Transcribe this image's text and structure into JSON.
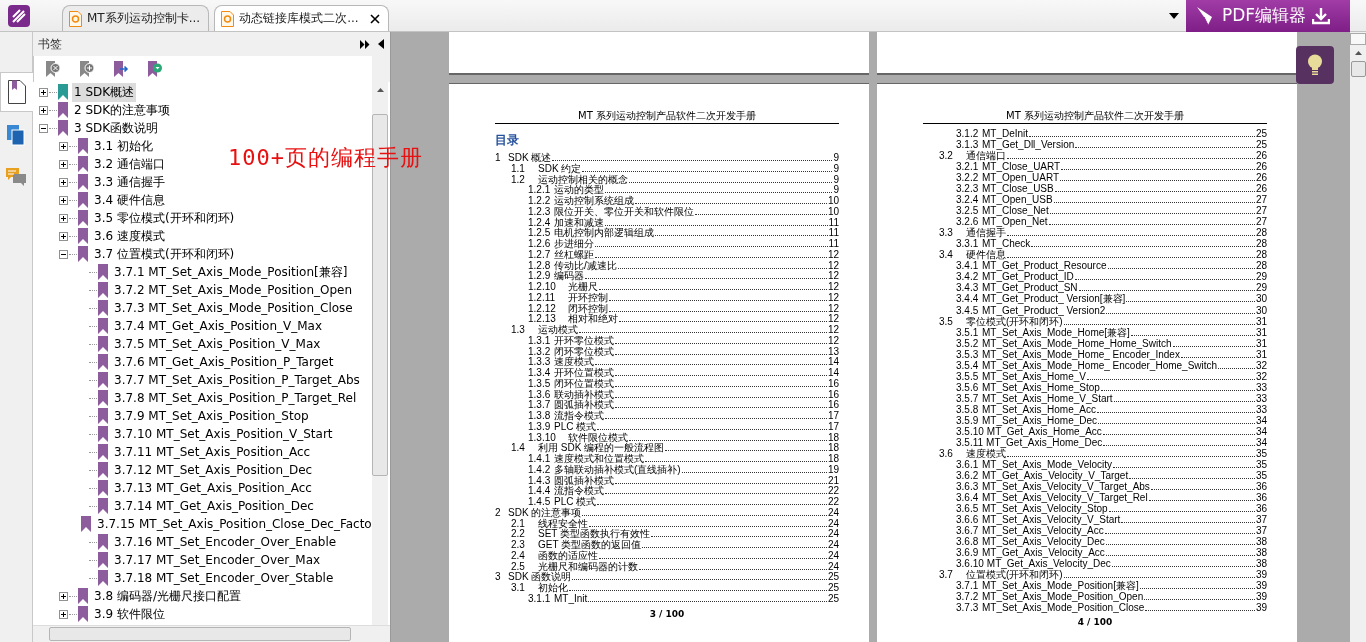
{
  "tabs": [
    {
      "title": "MT系列运动控制卡...",
      "selected": false,
      "closable": false
    },
    {
      "title": "动态链接库模式二次...",
      "selected": true,
      "closable": true
    }
  ],
  "promo_button": {
    "label": "PDF编辑器"
  },
  "side_strip": [
    {
      "kind": "pages",
      "selected": true
    },
    {
      "kind": "layers",
      "selected": false
    },
    {
      "kind": "comments",
      "selected": false
    }
  ],
  "bookmarks": {
    "title": "书签",
    "tree": [
      {
        "label": "1 SDK概述",
        "selected": true,
        "expanded": false
      },
      {
        "label": "2 SDK的注意事项",
        "selected": false,
        "expanded": false
      },
      {
        "label": "3 SDK函数说明",
        "selected": false,
        "expanded": true,
        "children": [
          {
            "label": "3.1 初始化",
            "selected": false,
            "expanded": false
          },
          {
            "label": "3.2 通信端口",
            "selected": false,
            "expanded": false
          },
          {
            "label": "3.3 通信握手",
            "selected": false,
            "expanded": false
          },
          {
            "label": "3.4 硬件信息",
            "selected": false,
            "expanded": false
          },
          {
            "label": "3.5 零位模式(开环和闭环)",
            "selected": false,
            "expanded": false
          },
          {
            "label": "3.6 速度模式",
            "selected": false,
            "expanded": false
          },
          {
            "label": "3.7 位置模式(开环和闭环)",
            "selected": false,
            "expanded": true,
            "children": [
              {
                "label": "3.7.1 MT_Set_Axis_Mode_Position[兼容]",
                "selected": false
              },
              {
                "label": "3.7.2 MT_Set_Axis_Mode_Position_Open",
                "selected": false
              },
              {
                "label": "3.7.3 MT_Set_Axis_Mode_Position_Close",
                "selected": false
              },
              {
                "label": "3.7.4 MT_Get_Axis_Position_V_Max",
                "selected": false
              },
              {
                "label": "3.7.5 MT_Set_Axis_Position_V_Max",
                "selected": false
              },
              {
                "label": "3.7.6 MT_Get_Axis_Position_P_Target",
                "selected": false
              },
              {
                "label": "3.7.7  MT_Set_Axis_Position_P_Target_Abs",
                "selected": false
              },
              {
                "label": "3.7.8 MT_Set_Axis_Position_P_Target_Rel",
                "selected": false
              },
              {
                "label": "3.7.9 MT_Set_Axis_Position_Stop",
                "selected": false
              },
              {
                "label": "3.7.10 MT_Set_Axis_Position_V_Start",
                "selected": false
              },
              {
                "label": "3.7.11 MT_Set_Axis_Position_Acc",
                "selected": false
              },
              {
                "label": "3.7.12 MT_Set_Axis_Position_Dec",
                "selected": false
              },
              {
                "label": "3.7.13 MT_Get_Axis_Position_Acc",
                "selected": false
              },
              {
                "label": "3.7.14 MT_Get_Axis_Position_Dec",
                "selected": false
              },
              {
                "label": "3.7.15 MT_Set_Axis_Position_Close_Dec_Facto",
                "selected": false
              },
              {
                "label": "3.7.16 MT_Set_Encoder_Over_Enable",
                "selected": false
              },
              {
                "label": "3.7.17 MT_Set_Encoder_Over_Max",
                "selected": false
              },
              {
                "label": "3.7.18 MT_Set_Encoder_Over_Stable",
                "selected": false
              }
            ]
          },
          {
            "label": "3.8 编码器/光栅尺接口配置",
            "selected": false,
            "expanded": false
          },
          {
            "label": "3.9 软件限位",
            "selected": false,
            "expanded": false
          }
        ]
      }
    ]
  },
  "annotation": "100+页的编程手册",
  "pages": [
    {
      "header": "MT 系列运动控制产品软件二次开发手册",
      "heading": "目录",
      "footer": "3 / 100",
      "entries": [
        {
          "num": "1",
          "title": "SDK 概述",
          "page": "9",
          "kind": "chapter"
        },
        {
          "num": "1.1",
          "title": "SDK 约定",
          "page": "9",
          "kind": "section"
        },
        {
          "num": "1.2",
          "title": "运动控制相关的概念",
          "page": "9",
          "kind": "section"
        },
        {
          "num": "1.2.1",
          "title": "运动的类型",
          "page": "9",
          "kind": "item"
        },
        {
          "num": "1.2.2",
          "title": "运动控制系统组成",
          "page": "10",
          "kind": "item"
        },
        {
          "num": "1.2.3",
          "title": "限位开关、零位开关和软件限位",
          "page": "10",
          "kind": "item"
        },
        {
          "num": "1.2.4",
          "title": "加速和减速",
          "page": "11",
          "kind": "item"
        },
        {
          "num": "1.2.5",
          "title": "电机控制内部逻辑组成",
          "page": "11",
          "kind": "item"
        },
        {
          "num": "1.2.6",
          "title": "步进细分",
          "page": "11",
          "kind": "item"
        },
        {
          "num": "1.2.7",
          "title": "丝杠螺距",
          "page": "12",
          "kind": "item"
        },
        {
          "num": "1.2.8",
          "title": "传动比/减速比",
          "page": "12",
          "kind": "item"
        },
        {
          "num": "1.2.9",
          "title": "编码器",
          "page": "12",
          "kind": "item"
        },
        {
          "num": "1.2.10",
          "title": "光栅尺",
          "page": "12",
          "kind": "item_wide"
        },
        {
          "num": "1.2.11",
          "title": "开环控制",
          "page": "12",
          "kind": "item_wide"
        },
        {
          "num": "1.2.12",
          "title": "闭环控制",
          "page": "12",
          "kind": "item_wide"
        },
        {
          "num": "1.2.13",
          "title": "相对和绝对",
          "page": "12",
          "kind": "item_wide"
        },
        {
          "num": "1.3",
          "title": "运动模式",
          "page": "12",
          "kind": "section"
        },
        {
          "num": "1.3.1",
          "title": "开环零位模式",
          "page": "12",
          "kind": "item"
        },
        {
          "num": "1.3.2",
          "title": "闭环零位模式",
          "page": "13",
          "kind": "item"
        },
        {
          "num": "1.3.3",
          "title": "速度模式",
          "page": "14",
          "kind": "item"
        },
        {
          "num": "1.3.4",
          "title": "开环位置模式",
          "page": "14",
          "kind": "item"
        },
        {
          "num": "1.3.5",
          "title": "闭环位置模式",
          "page": "16",
          "kind": "item"
        },
        {
          "num": "1.3.6",
          "title": "联动插补模式",
          "page": "16",
          "kind": "item"
        },
        {
          "num": "1.3.7",
          "title": "圆弧插补模式",
          "page": "16",
          "kind": "item"
        },
        {
          "num": "1.3.8",
          "title": "流指令模式",
          "page": "17",
          "kind": "item"
        },
        {
          "num": "1.3.9",
          "title": "PLC 模式",
          "page": "17",
          "kind": "item"
        },
        {
          "num": "1.3.10",
          "title": "软件限位模式",
          "page": "18",
          "kind": "item_wide"
        },
        {
          "num": "1.4",
          "title": "利用 SDK 编程的一般流程图",
          "page": "18",
          "kind": "section"
        },
        {
          "num": "1.4.1",
          "title": "速度模式和位置模式",
          "page": "18",
          "kind": "item"
        },
        {
          "num": "1.4.2",
          "title": "多轴联动插补模式(直线插补)",
          "page": "19",
          "kind": "item"
        },
        {
          "num": "1.4.3",
          "title": "圆弧插补模式",
          "page": "21",
          "kind": "item"
        },
        {
          "num": "1.4.4",
          "title": "流指令模式",
          "page": "22",
          "kind": "item"
        },
        {
          "num": "1.4.5",
          "title": "PLC 模式",
          "page": "22",
          "kind": "item"
        },
        {
          "num": "2",
          "title": "SDK 的注意事项",
          "page": "24",
          "kind": "chapter"
        },
        {
          "num": "2.1",
          "title": "线程安全性",
          "page": "24",
          "kind": "section"
        },
        {
          "num": "2.2",
          "title": "SET 类型函数执行有效性",
          "page": "24",
          "kind": "section"
        },
        {
          "num": "2.3",
          "title": "GET 类型函数的返回值",
          "page": "24",
          "kind": "section"
        },
        {
          "num": "2.4",
          "title": "函数的适应性",
          "page": "24",
          "kind": "section"
        },
        {
          "num": "2.5",
          "title": "光栅尺和编码器的计数",
          "page": "24",
          "kind": "section"
        },
        {
          "num": "3",
          "title": "SDK 函数说明",
          "page": "25",
          "kind": "chapter"
        },
        {
          "num": "3.1",
          "title": "初始化",
          "page": "25",
          "kind": "section"
        },
        {
          "num": "3.1.1",
          "title": "MT_Init",
          "page": "25",
          "kind": "item"
        }
      ]
    },
    {
      "header": "MT 系列运动控制产品软件二次开发手册",
      "footer": "4 / 100",
      "entries": [
        {
          "num": "3.1.2",
          "title": "MT_DeInit",
          "page": "25",
          "kind": "item"
        },
        {
          "num": "3.1.3",
          "title": "MT_Get_Dll_Version",
          "page": "25",
          "kind": "item"
        },
        {
          "num": "3.2",
          "title": "通信端口",
          "page": "26",
          "kind": "section"
        },
        {
          "num": "3.2.1",
          "title": "MT_Close_UART",
          "page": "26",
          "kind": "item"
        },
        {
          "num": "3.2.2",
          "title": "MT_Open_UART",
          "page": "26",
          "kind": "item"
        },
        {
          "num": "3.2.3",
          "title": "MT_Close_USB",
          "page": "26",
          "kind": "item"
        },
        {
          "num": "3.2.4",
          "title": "MT_Open_USB",
          "page": "27",
          "kind": "item"
        },
        {
          "num": "3.2.5",
          "title": "MT_Close_Net",
          "page": "27",
          "kind": "item"
        },
        {
          "num": "3.2.6",
          "title": "MT_Open_Net",
          "page": "27",
          "kind": "item"
        },
        {
          "num": "3.3",
          "title": "通信握手",
          "page": "28",
          "kind": "section"
        },
        {
          "num": "3.3.1",
          "title": "MT_Check",
          "page": "28",
          "kind": "item"
        },
        {
          "num": "3.4",
          "title": "硬件信息",
          "page": "28",
          "kind": "section"
        },
        {
          "num": "3.4.1",
          "title": "MT_Get_Product_Resource",
          "page": "28",
          "kind": "item"
        },
        {
          "num": "3.4.2",
          "title": "MT_Get_Product_ID",
          "page": "29",
          "kind": "item"
        },
        {
          "num": "3.4.3",
          "title": "MT_Get_Product_SN",
          "page": "29",
          "kind": "item"
        },
        {
          "num": "3.4.4",
          "title": "MT_Get_Product_ Version[兼容]",
          "page": "30",
          "kind": "item"
        },
        {
          "num": "3.4.5",
          "title": "MT_Get_Product_ Version2",
          "page": "30",
          "kind": "item"
        },
        {
          "num": "3.5",
          "title": "零位模式(开环和闭环)",
          "page": "31",
          "kind": "section"
        },
        {
          "num": "3.5.1",
          "title": "MT_Set_Axis_Mode_Home[兼容]",
          "page": "31",
          "kind": "item"
        },
        {
          "num": "3.5.2",
          "title": "MT_Set_Axis_Mode_Home_Home_Switch",
          "page": "31",
          "kind": "item"
        },
        {
          "num": "3.5.3",
          "title": "MT_Set_Axis_Mode_Home_ Encoder_Index",
          "page": "31",
          "kind": "item"
        },
        {
          "num": "3.5.4",
          "title": "MT_Set_Axis_Mode_Home_ Encoder_Home_Switch",
          "page": "32",
          "kind": "item"
        },
        {
          "num": "3.5.5",
          "title": "MT_Set_Axis_Home_V",
          "page": "32",
          "kind": "item"
        },
        {
          "num": "3.5.6",
          "title": "MT_Set_Axis_Home_Stop",
          "page": "33",
          "kind": "item"
        },
        {
          "num": "3.5.7",
          "title": "MT_Set_Axis_Home_V_Start",
          "page": "33",
          "kind": "item"
        },
        {
          "num": "3.5.8",
          "title": "MT_Set_Axis_Home_Acc",
          "page": "33",
          "kind": "item"
        },
        {
          "num": "3.5.9",
          "title": "MT_Set_Axis_Home_Dec",
          "page": "34",
          "kind": "item"
        },
        {
          "num": "3.5.10",
          "title": "MT_Get_Axis_Home_Acc",
          "page": "34",
          "kind": "item"
        },
        {
          "num": "3.5.11",
          "title": "MT_Get_Axis_Home_Dec",
          "page": "34",
          "kind": "item"
        },
        {
          "num": "3.6",
          "title": "速度模式",
          "page": "35",
          "kind": "section"
        },
        {
          "num": "3.6.1",
          "title": "MT_Set_Axis_Mode_Velocity",
          "page": "35",
          "kind": "item"
        },
        {
          "num": "3.6.2",
          "title": "MT_Get_Axis_Velocity_V_Target",
          "page": "35",
          "kind": "item"
        },
        {
          "num": "3.6.3",
          "title": "MT_Set_Axis_Velocity_V_Target_Abs",
          "page": "36",
          "kind": "item"
        },
        {
          "num": "3.6.4",
          "title": "MT_Set_Axis_Velocity_V_Target_Rel",
          "page": "36",
          "kind": "item"
        },
        {
          "num": "3.6.5",
          "title": "MT_Set_Axis_Velocity_Stop",
          "page": "36",
          "kind": "item"
        },
        {
          "num": "3.6.6",
          "title": "MT_Set_Axis_Velocity_V_Start",
          "page": "37",
          "kind": "item"
        },
        {
          "num": "3.6.7",
          "title": "MT_Set_Axis_Velocity_Acc",
          "page": "37",
          "kind": "item"
        },
        {
          "num": "3.6.8",
          "title": "MT_Set_Axis_Velocity_Dec",
          "page": "38",
          "kind": "item"
        },
        {
          "num": "3.6.9",
          "title": "MT_Get_Axis_Velocity_Acc",
          "page": "38",
          "kind": "item"
        },
        {
          "num": "3.6.10",
          "title": "MT_Get_Axis_Velocity_Dec",
          "page": "38",
          "kind": "item"
        },
        {
          "num": "3.7",
          "title": "位置模式(开环和闭环)",
          "page": "39",
          "kind": "section"
        },
        {
          "num": "3.7.1",
          "title": "MT_Set_Axis_Mode_Position[兼容]",
          "page": "39",
          "kind": "item"
        },
        {
          "num": "3.7.2",
          "title": "MT_Set_Axis_Mode_Position_Open",
          "page": "39",
          "kind": "item"
        },
        {
          "num": "3.7.3",
          "title": "MT_Set_Axis_Mode_Position_Close",
          "page": "39",
          "kind": "item"
        }
      ]
    }
  ]
}
